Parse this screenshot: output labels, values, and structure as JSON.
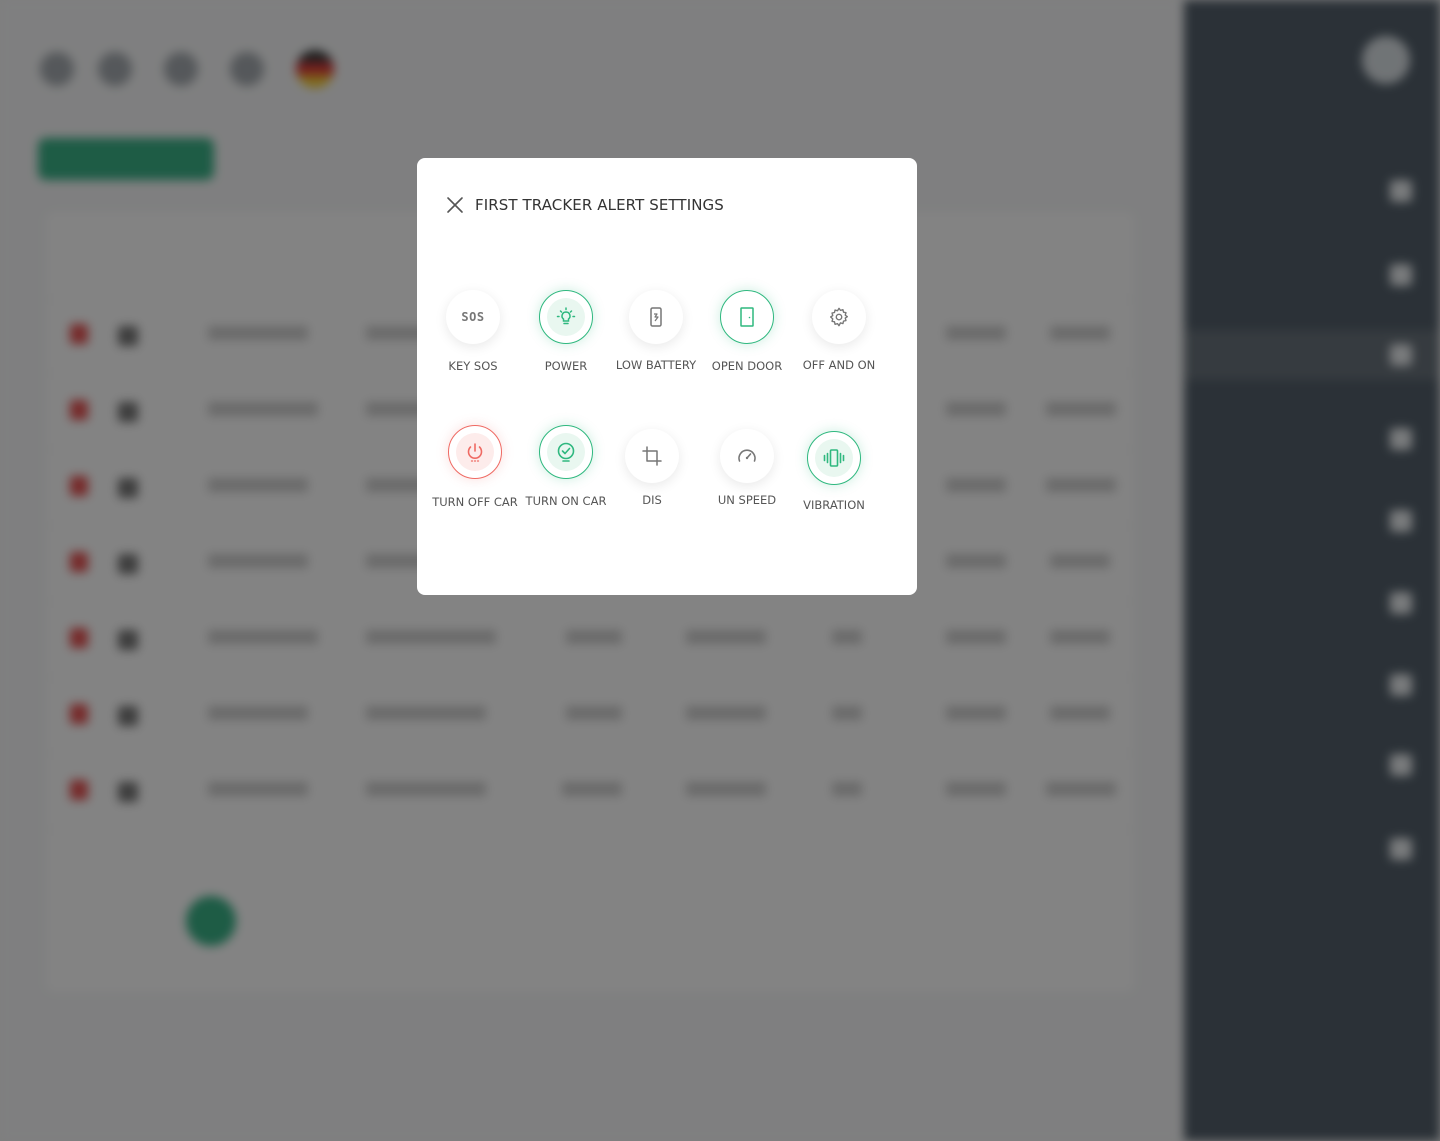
{
  "background": {
    "add_button": "",
    "page_heading": "",
    "page_subtitle": "",
    "table_headers": [],
    "pagination": [
      "",
      "",
      ""
    ],
    "sidebar": {
      "user_name": "",
      "items": []
    }
  },
  "modal": {
    "title": "FIRST TRACKER ALERT SETTINGS",
    "alerts": [
      {
        "label": "KEY  SOS",
        "icon": "sos-icon",
        "state": "off"
      },
      {
        "label": "POWER",
        "icon": "bulb-icon",
        "state": "on"
      },
      {
        "label": "LOW BATTERY",
        "icon": "battery-icon",
        "state": "off"
      },
      {
        "label": "OPEN DOOR",
        "icon": "door-icon",
        "state": "on"
      },
      {
        "label": "OFF AND ON",
        "icon": "gear-icon",
        "state": "off"
      },
      {
        "label": "TURN OFF CAR",
        "icon": "power-icon",
        "state": "danger"
      },
      {
        "label": "TURN ON CAR",
        "icon": "check-icon",
        "state": "on"
      },
      {
        "label": "DIS",
        "icon": "crop-icon",
        "state": "off"
      },
      {
        "label": "UN SPEED",
        "icon": "speedometer-icon",
        "state": "off"
      },
      {
        "label": "VIBRATION",
        "icon": "vibration-icon",
        "state": "on"
      }
    ],
    "sos_glyph": "SOS",
    "colors": {
      "on": "#2fb87f",
      "danger": "#ef6a63",
      "off": "#777777"
    }
  }
}
